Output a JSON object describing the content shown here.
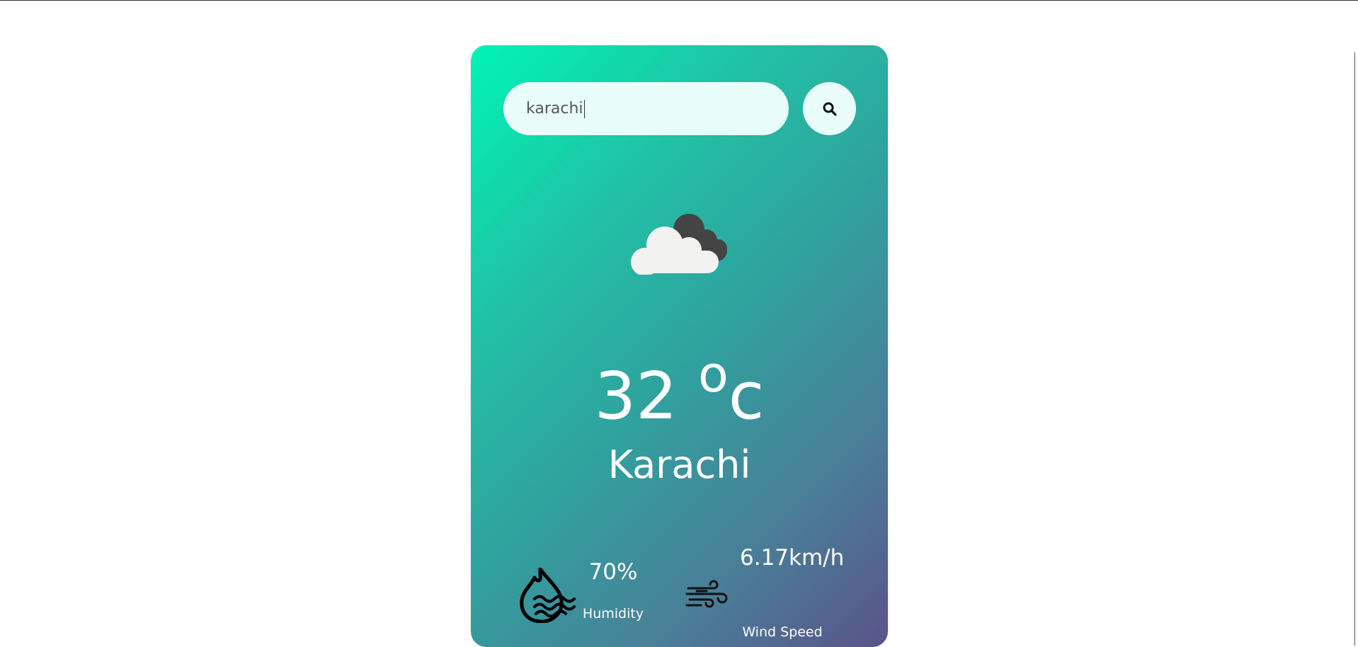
{
  "search": {
    "value": "karachi",
    "button_icon": "search-icon"
  },
  "weather": {
    "condition_icon": "cloudy-icon",
    "temperature": "32",
    "unit": "o",
    "unit_suffix": "c",
    "city": "Karachi"
  },
  "details": {
    "humidity": {
      "icon": "humidity-icon",
      "value": "70%",
      "label": "Humidity"
    },
    "wind": {
      "icon": "wind-icon",
      "value": "6.17km/h",
      "label": "Wind Speed"
    }
  },
  "colors": {
    "gradient_start": "#00f5b6",
    "gradient_end": "#5a538a",
    "input_bg": "#e9fdfa",
    "text": "#ffffff"
  }
}
